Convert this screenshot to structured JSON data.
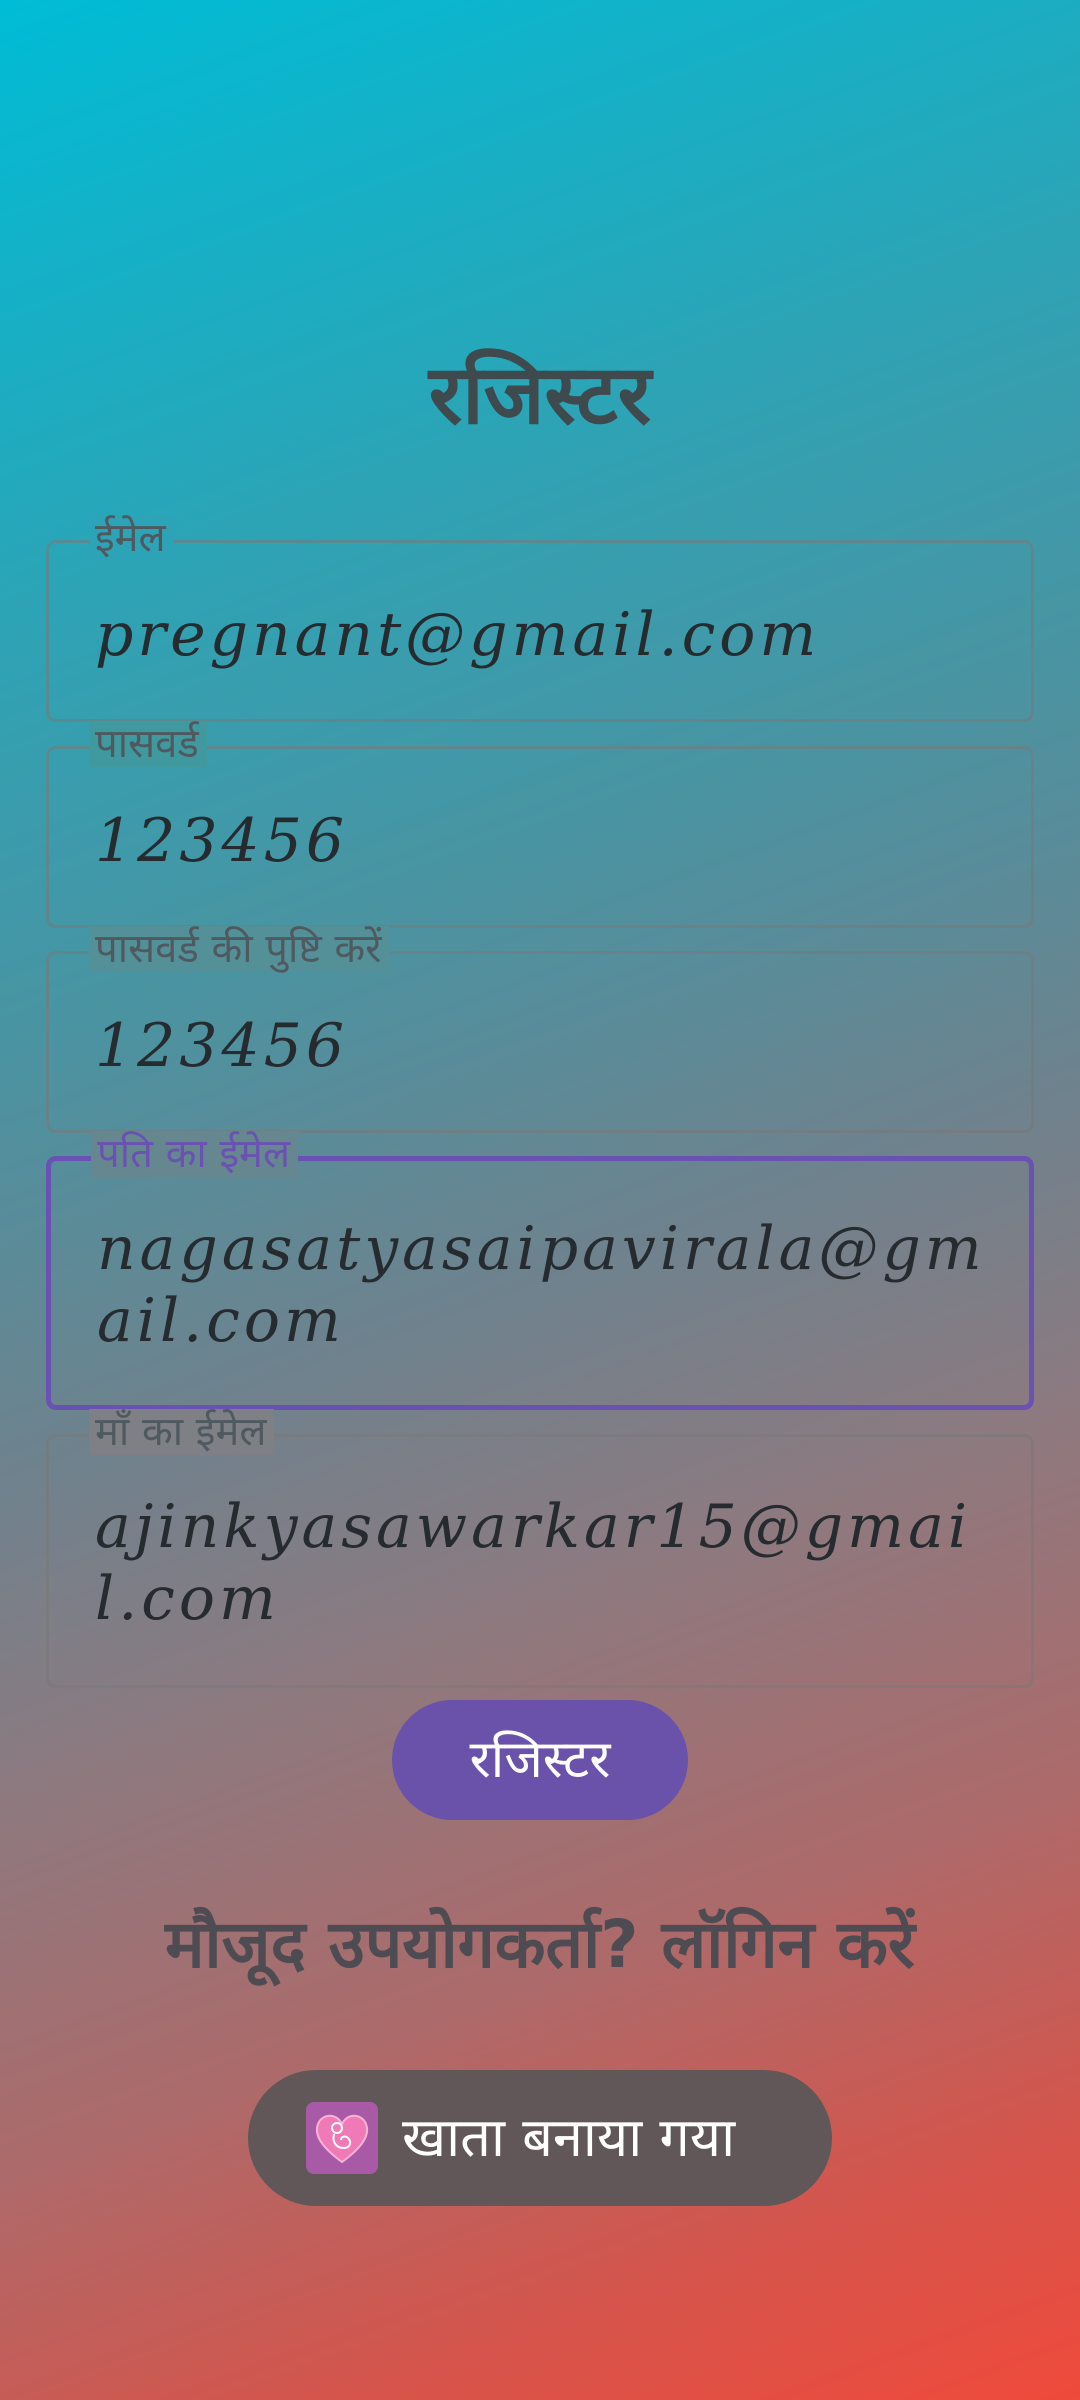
{
  "page": {
    "title": "रजिस्टर"
  },
  "form": {
    "email": {
      "label": "ईमेल",
      "value": "pregnant@gmail.com"
    },
    "password": {
      "label": "पासवर्ड",
      "value": "123456"
    },
    "confirm_password": {
      "label": "पासवर्ड की पुष्टि करें",
      "value": "123456"
    },
    "husband_email": {
      "label": "पति का ईमेल",
      "value": "nagasatyasaipavirala@gmail.com"
    },
    "mother_email": {
      "label": "माँ का ईमेल",
      "value": "ajinkyasawarkar15@gmail.com"
    }
  },
  "actions": {
    "register_label": "रजिस्टर",
    "login_link": "मौजूद उपयोगकर्ता? लॉगिन करें"
  },
  "toast": {
    "icon": "pregnancy-heart-app-icon",
    "message": "खाता बनाया गया"
  },
  "colors": {
    "accent": "#6a52aa",
    "gradient_top": "#00bcd6",
    "gradient_bottom": "#ef4a3b"
  }
}
